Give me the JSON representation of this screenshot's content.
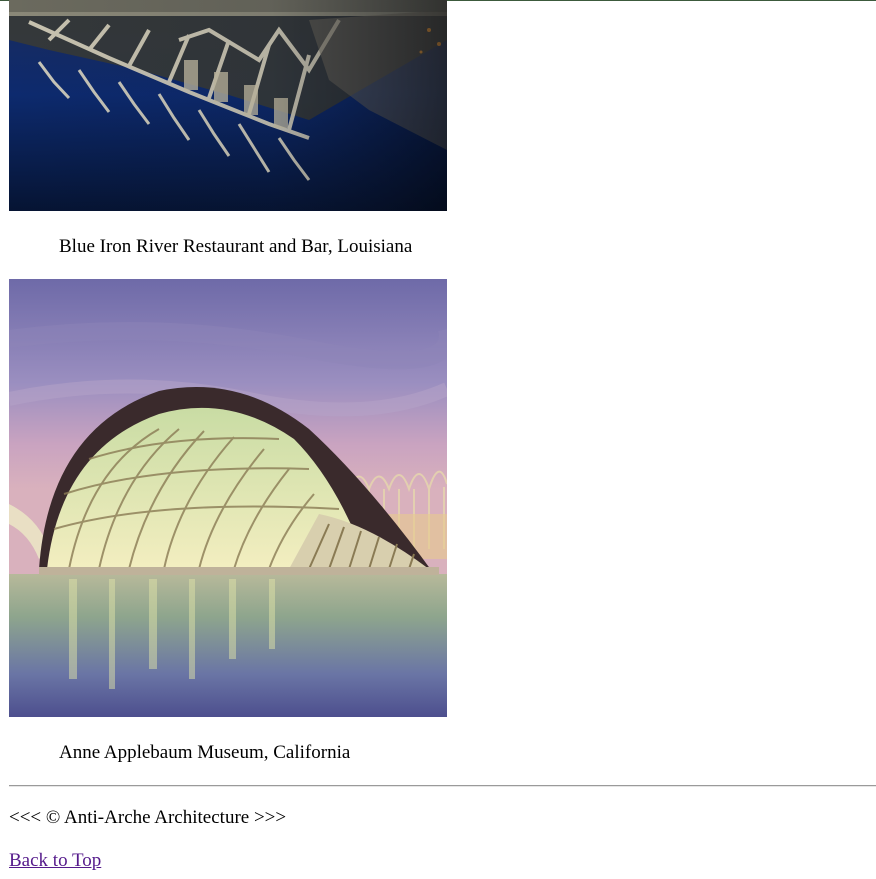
{
  "gallery": {
    "items": [
      {
        "caption": "Blue Iron River Restaurant and Bar, Louisiana"
      },
      {
        "caption": "Anne Applebaum Museum, California"
      }
    ]
  },
  "footer": {
    "copyright_text": "<<< © Anti-Arche Architecture >>>",
    "back_to_top_label": "Back to Top"
  },
  "colors": {
    "link_visited": "#551a8b",
    "rule": "#9a9a9a"
  }
}
